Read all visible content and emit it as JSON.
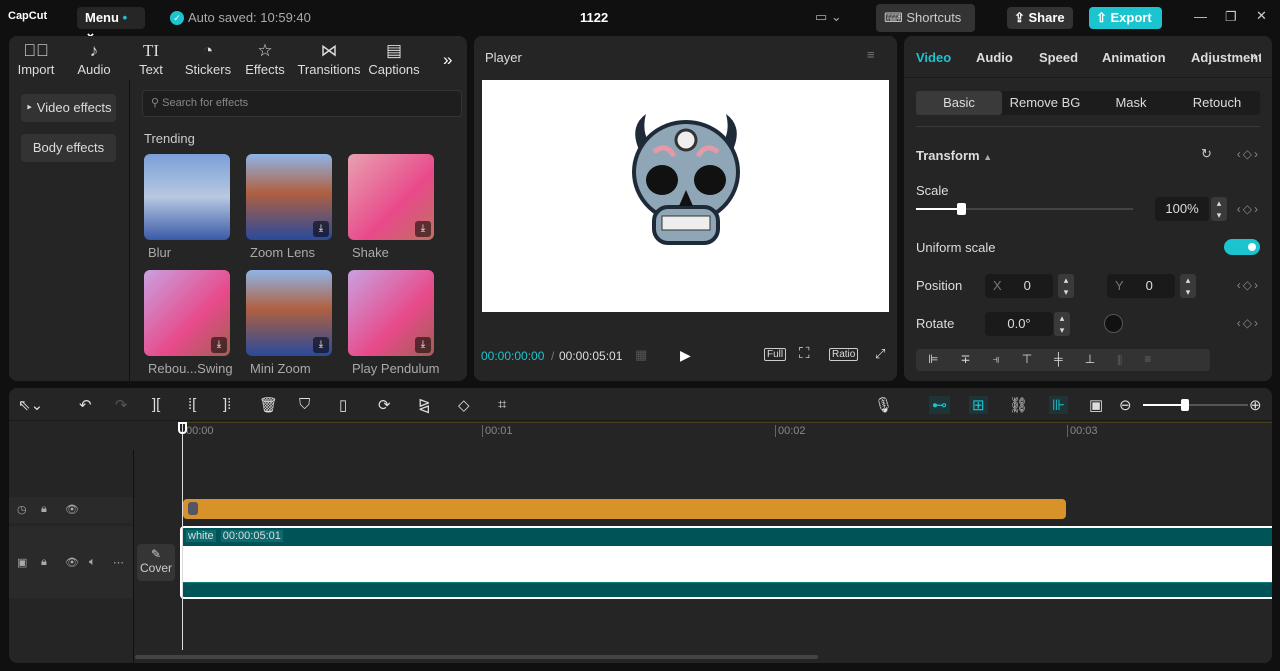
{
  "titlebar": {
    "logo": "CapCut",
    "menu": "Menu",
    "autosave": "Auto saved: 10:59:40",
    "project": "1122",
    "shortcuts": "Shortcuts",
    "share": "Share",
    "export": "Export"
  },
  "media_tabs": [
    {
      "label": "Import",
      "icon": "import-icon"
    },
    {
      "label": "Audio",
      "icon": "audio-icon"
    },
    {
      "label": "Text",
      "icon": "text-icon"
    },
    {
      "label": "Stickers",
      "icon": "stickers-icon"
    },
    {
      "label": "Effects",
      "icon": "effects-icon",
      "active": true
    },
    {
      "label": "Transitions",
      "icon": "transitions-icon"
    },
    {
      "label": "Captions",
      "icon": "captions-icon"
    }
  ],
  "effects": {
    "categories": [
      {
        "label": "Video effects",
        "active": true
      },
      {
        "label": "Body effects"
      }
    ],
    "search_placeholder": "Search for effects",
    "section": "Trending",
    "items": [
      {
        "label": "Blur"
      },
      {
        "label": "Zoom Lens"
      },
      {
        "label": "Shake"
      },
      {
        "label": "Rebou...Swing"
      },
      {
        "label": "Mini Zoom"
      },
      {
        "label": "Play Pendulum"
      }
    ]
  },
  "player": {
    "title": "Player",
    "current_time": "00:00:00:00",
    "separator": "/",
    "duration": "00:00:05:01",
    "full": "Full",
    "ratio": "Ratio"
  },
  "inspector": {
    "tabs": [
      "Video",
      "Audio",
      "Speed",
      "Animation",
      "Adjustment"
    ],
    "subtabs": [
      "Basic",
      "Remove BG",
      "Mask",
      "Retouch"
    ],
    "transform": "Transform",
    "scale_label": "Scale",
    "scale_value": "100%",
    "scale_percent": 100,
    "uniform_scale": "Uniform scale",
    "uniform_on": true,
    "position_label": "Position",
    "x_label": "X",
    "x_value": "0",
    "y_label": "Y",
    "y_value": "0",
    "rotate_label": "Rotate",
    "rotate_value": "0.0°"
  },
  "timeline": {
    "ticks": [
      "00:00",
      "00:01",
      "00:02",
      "00:03"
    ],
    "cover": "Cover",
    "clip_name": "white",
    "clip_duration": "00:00:05:01",
    "sticker_color": "#d8922a",
    "video_color": "#005457"
  },
  "colors": {
    "accent": "#1cc4d0"
  }
}
